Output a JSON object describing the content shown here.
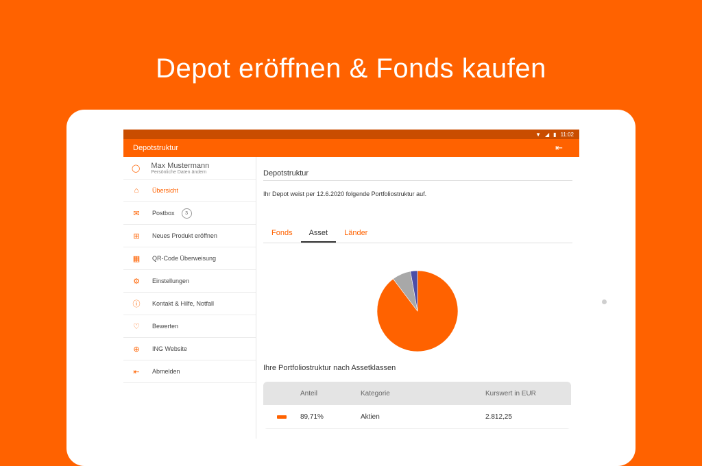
{
  "headline": "Depot eröffnen & Fonds kaufen",
  "status_bar": {
    "time": "11:02"
  },
  "app_bar": {
    "title": "Depotstruktur"
  },
  "profile": {
    "name": "Max Mustermann",
    "subtitle": "Persönliche Daten ändern"
  },
  "sidebar": {
    "items": [
      {
        "label": "Übersicht",
        "icon": "home-icon",
        "active": true
      },
      {
        "label": "Postbox",
        "icon": "mail-icon",
        "badge": "3"
      },
      {
        "label": "Neues Produkt eröffnen",
        "icon": "plus-box-icon"
      },
      {
        "label": "QR-Code Überweisung",
        "icon": "qr-code-icon"
      },
      {
        "label": "Einstellungen",
        "icon": "gear-icon"
      },
      {
        "label": "Kontakt & Hilfe, Notfall",
        "icon": "info-icon"
      },
      {
        "label": "Bewerten",
        "icon": "heart-icon"
      },
      {
        "label": "ING Website",
        "icon": "globe-icon"
      },
      {
        "label": "Abmelden",
        "icon": "logout-icon"
      }
    ]
  },
  "main": {
    "section_title": "Depotstruktur",
    "intro": "Ihr Depot weist per 12.6.2020 folgende Portfoliostruktur auf.",
    "tabs": [
      {
        "label": "Fonds"
      },
      {
        "label": "Asset",
        "active": true
      },
      {
        "label": "Länder"
      }
    ],
    "table_title": "Ihre Portfoliostruktur nach Assetklassen",
    "table": {
      "headers": [
        "Anteil",
        "Kategorie",
        "Kurswert in EUR"
      ],
      "rows": [
        {
          "share": "89,71%",
          "category": "Aktien",
          "value": "2.812,25",
          "color": "#ff6200"
        }
      ]
    }
  },
  "chart_data": {
    "type": "pie",
    "slices": [
      {
        "value": 89.71,
        "color": "#ff6200"
      },
      {
        "value": 7.5,
        "color": "#a8a8a8"
      },
      {
        "value": 2.79,
        "color": "#4b4ea8"
      }
    ]
  }
}
